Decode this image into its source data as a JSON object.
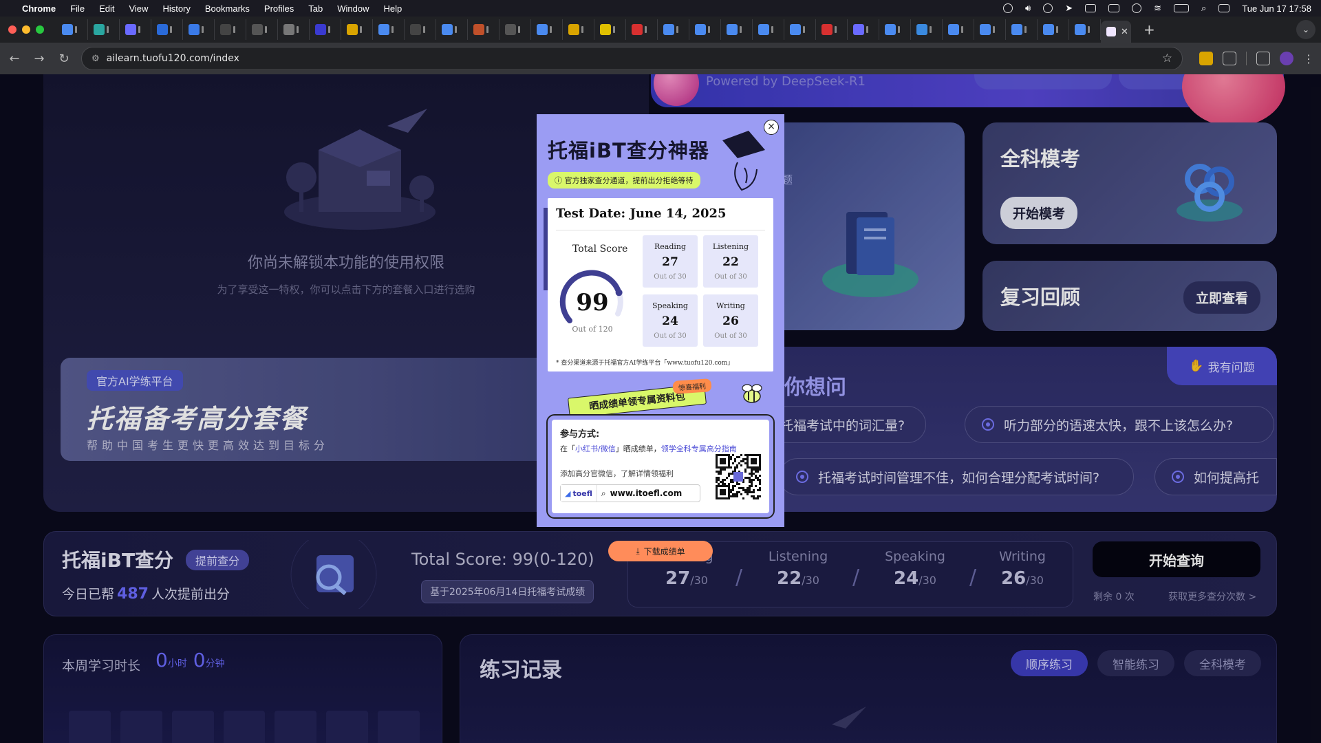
{
  "menubar": {
    "app": "Chrome",
    "items": [
      "File",
      "Edit",
      "View",
      "History",
      "Bookmarks",
      "Profiles",
      "Tab",
      "Window",
      "Help"
    ],
    "clock": "Tue Jun 17  17:58"
  },
  "browser": {
    "url": "ailearn.tuofu120.com/index",
    "tab_count": 34,
    "new_tab": "+"
  },
  "locked": {
    "title": "你尚未解锁本功能的使用权限",
    "subtitle": "为了享受这一特权，你可以点击下方的套餐入口进行选购"
  },
  "banner": {
    "chip": "官方AI学练平台",
    "headline": "托福备考高分套餐",
    "tagline": "帮助中国考生更快更高效达到目标分"
  },
  "hero": {
    "powered": "Powered by DeepSeek-R1",
    "practice_label": "真题"
  },
  "cards": {
    "mock_title": "全科模考",
    "mock_button": "开始模考",
    "review_title": "复习回顾",
    "review_button": "立即查看"
  },
  "qa": {
    "title": "你想问",
    "ask_button": "我有问题",
    "questions": [
      "高托福考试中的词汇量?",
      "听力部分的语速太快，跟不上该怎么办?",
      "托福考试时间管理不佳，如何合理分配考试时间?",
      "如何提高托"
    ]
  },
  "scorebar": {
    "title": "托福iBT查分",
    "badge": "提前查分",
    "help_prefix": "今日已帮",
    "help_count": "487",
    "help_suffix": "人次提前出分",
    "total": "Total Score:   99(0-120)",
    "basis": "基于2025年06月14日托福考试成绩",
    "sections": [
      {
        "name": "Reading",
        "score": "27",
        "max": "/30"
      },
      {
        "name": "Listening",
        "score": "22",
        "max": "/30"
      },
      {
        "name": "Speaking",
        "score": "24",
        "max": "/30"
      },
      {
        "name": "Writing",
        "score": "26",
        "max": "/30"
      }
    ],
    "query_button": "开始查询",
    "remaining": "剩余 0 次",
    "more": "获取更多查分次数 >"
  },
  "week": {
    "label": "本周学习时长",
    "hours": "0",
    "hours_unit": "小时",
    "minutes": "0",
    "minutes_unit": "分钟"
  },
  "record": {
    "title": "练习记录",
    "tabs": [
      "顺序练习",
      "智能练习",
      "全科模考"
    ]
  },
  "modal": {
    "title": "托福iBT查分神器",
    "subtitle": "ⓘ 官方独家查分通道，提前出分拒绝等待",
    "close": "×",
    "test_date": "Test Date: June 14, 2025",
    "total_label": "Total Score",
    "total_score": "99",
    "total_of": "Out of 120",
    "total_fraction": 0.825,
    "sections": [
      {
        "name": "Reading",
        "score": "27",
        "of": "Out of 30"
      },
      {
        "name": "Listening",
        "score": "22",
        "of": "Out of 30"
      },
      {
        "name": "Speaking",
        "score": "24",
        "of": "Out of 30"
      },
      {
        "name": "Writing",
        "score": "26",
        "of": "Out of 30"
      }
    ],
    "source": "* 查分渠道来源于托福官方AI学练平台「www.tuofu120.com」",
    "ribbon": "晒成绩单领专属资料包",
    "gift_tag": "惊喜福利",
    "join_title": "参与方式:",
    "join_desc_prefix": "在「",
    "join_desc_platform": "小红书/微信",
    "join_desc_mid": "」晒成绩单，",
    "join_desc_link": "领学全科专属高分指南",
    "wechat_note": "添加高分官微信，了解详情领福利",
    "brand": "toefl",
    "site": "www.itoefl.com"
  },
  "download_button": "下载成绩单"
}
